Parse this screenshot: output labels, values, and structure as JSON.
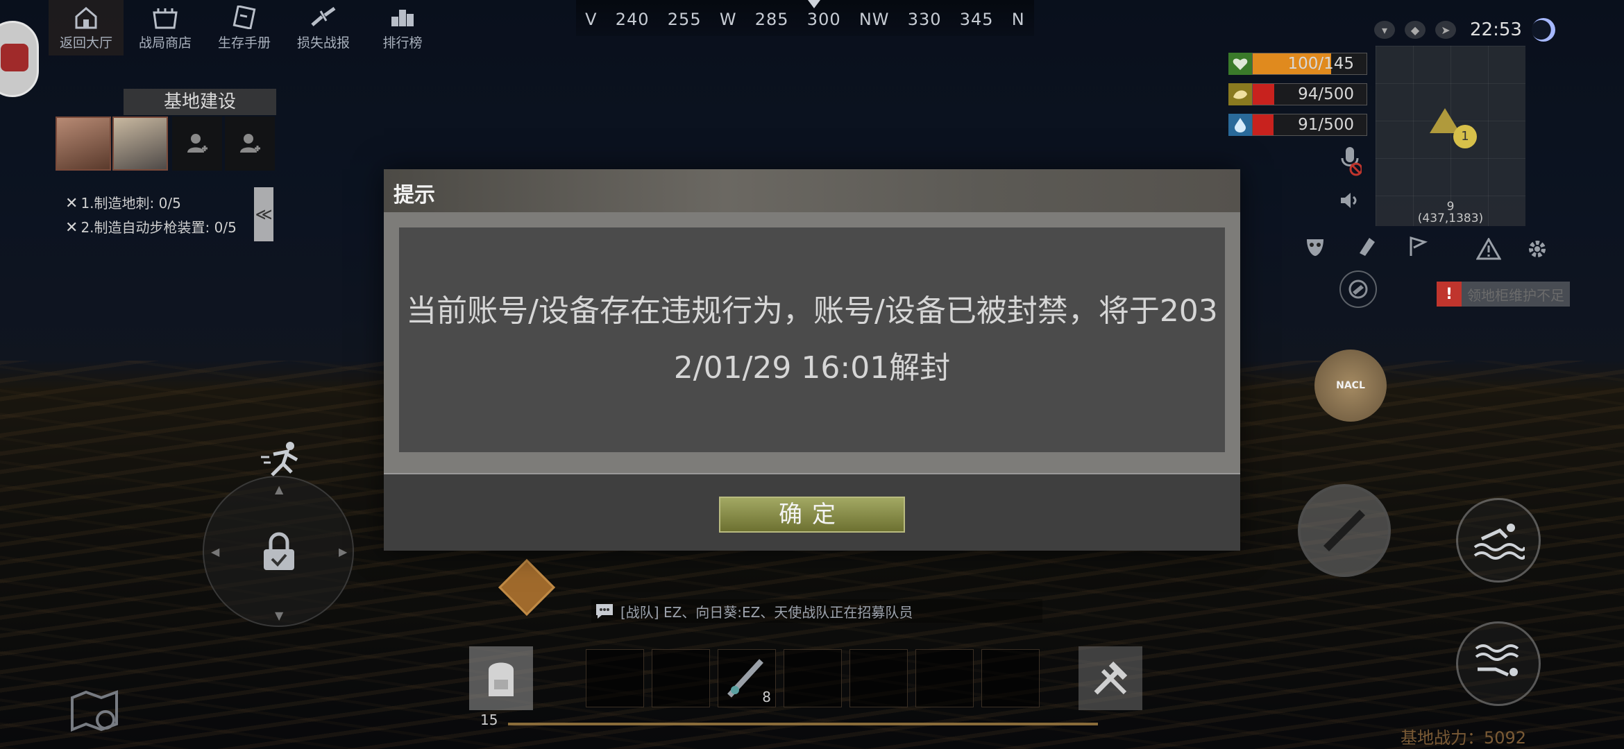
{
  "menu": {
    "items": [
      {
        "label": "返回大厅",
        "icon": "home-icon"
      },
      {
        "label": "战局商店",
        "icon": "shop-icon"
      },
      {
        "label": "生存手册",
        "icon": "book-icon"
      },
      {
        "label": "损失战报",
        "icon": "broken-weapon-icon"
      },
      {
        "label": "排行榜",
        "icon": "ranking-icon"
      }
    ]
  },
  "compass": {
    "ticks": [
      "V",
      "240",
      "255",
      "W",
      "285",
      "300",
      "NW",
      "330",
      "345",
      "N"
    ]
  },
  "base_building": {
    "title": "基地建设",
    "tasks": [
      "1.制造地刺: 0/5",
      "2.制造自动步枪装置: 0/5"
    ],
    "collapse_label": "≪"
  },
  "status": {
    "health": {
      "text": "100/145",
      "fraction": 0.69,
      "color": "#e08a1e"
    },
    "hunger": {
      "text": "94/500",
      "fraction": 0.19,
      "color": "#c8221e"
    },
    "thirst": {
      "text": "91/500",
      "fraction": 0.18,
      "color": "#c8221e"
    }
  },
  "clock": {
    "time": "22:53"
  },
  "minimap": {
    "pin_label": "1",
    "zone": "9",
    "coords": "(437,1383)"
  },
  "warning": {
    "text": "领地柜维护不足",
    "mark": "!"
  },
  "nacl_label": "NACL",
  "chat": {
    "message": "[战队]  EZ、向日葵:EZ、天使战队正在招募队员"
  },
  "hotbar": {
    "bag_count": "15",
    "weapon_qty": "8",
    "progress": 0.0
  },
  "base_power": {
    "text": "基地战力：5092"
  },
  "modal": {
    "title": "提示",
    "message": "当前账号/设备存在违规行为，账号/设备已被封禁，将于2032/01/29 16:01解封",
    "confirm_label": "确定"
  },
  "colors": {
    "health_icon_bg": "#3a7a2a",
    "hunger_icon_bg": "#8a7a20",
    "thirst_icon_bg": "#2a6a9a",
    "modal_button": "#8d9147",
    "warning_red": "#c0352d"
  }
}
